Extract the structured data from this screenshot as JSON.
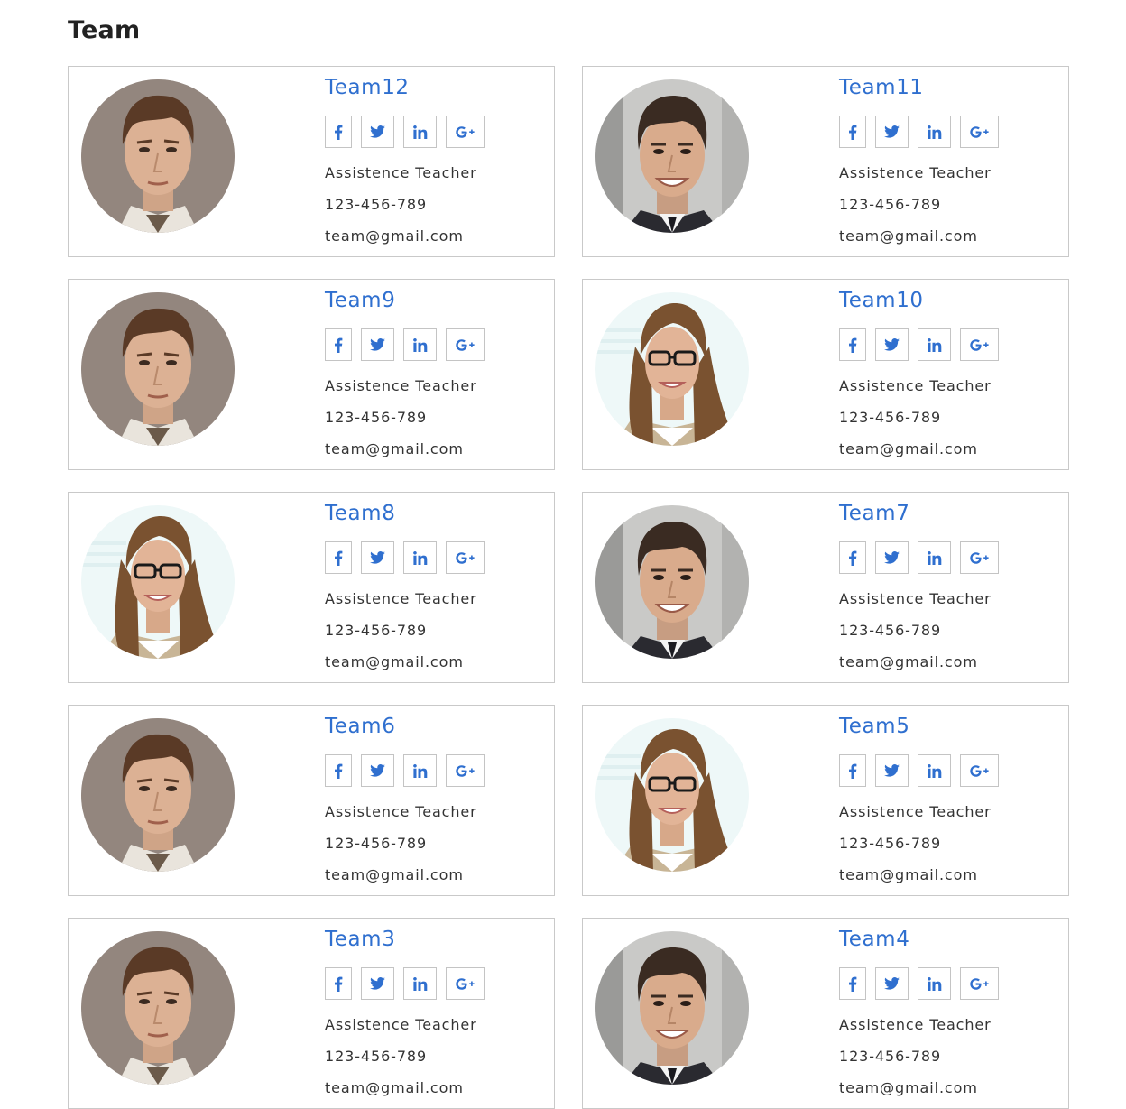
{
  "page": {
    "title": "Team"
  },
  "colors": {
    "accent": "#2f6fcf",
    "border": "#c9c9c9",
    "text": "#333333"
  },
  "social_icons": [
    "facebook-icon",
    "twitter-icon",
    "linkedin-icon",
    "google-plus-icon"
  ],
  "members": [
    {
      "name": "Team12",
      "role": "Assistence Teacher",
      "phone": "123-456-789",
      "email": "team@gmail.com",
      "photo": "man-serious"
    },
    {
      "name": "Team11",
      "role": "Assistence Teacher",
      "phone": "123-456-789",
      "email": "team@gmail.com",
      "photo": "man-smiling"
    },
    {
      "name": "Team9",
      "role": "Assistence Teacher",
      "phone": "123-456-789",
      "email": "team@gmail.com",
      "photo": "man-serious"
    },
    {
      "name": "Team10",
      "role": "Assistence Teacher",
      "phone": "123-456-789",
      "email": "team@gmail.com",
      "photo": "woman-glasses"
    },
    {
      "name": "Team8",
      "role": "Assistence Teacher",
      "phone": "123-456-789",
      "email": "team@gmail.com",
      "photo": "woman-glasses"
    },
    {
      "name": "Team7",
      "role": "Assistence Teacher",
      "phone": "123-456-789",
      "email": "team@gmail.com",
      "photo": "man-smiling"
    },
    {
      "name": "Team6",
      "role": "Assistence Teacher",
      "phone": "123-456-789",
      "email": "team@gmail.com",
      "photo": "man-serious"
    },
    {
      "name": "Team5",
      "role": "Assistence Teacher",
      "phone": "123-456-789",
      "email": "team@gmail.com",
      "photo": "woman-glasses"
    },
    {
      "name": "Team3",
      "role": "Assistence Teacher",
      "phone": "123-456-789",
      "email": "team@gmail.com",
      "photo": "man-serious"
    },
    {
      "name": "Team4",
      "role": "Assistence Teacher",
      "phone": "123-456-789",
      "email": "team@gmail.com",
      "photo": "man-smiling"
    }
  ]
}
